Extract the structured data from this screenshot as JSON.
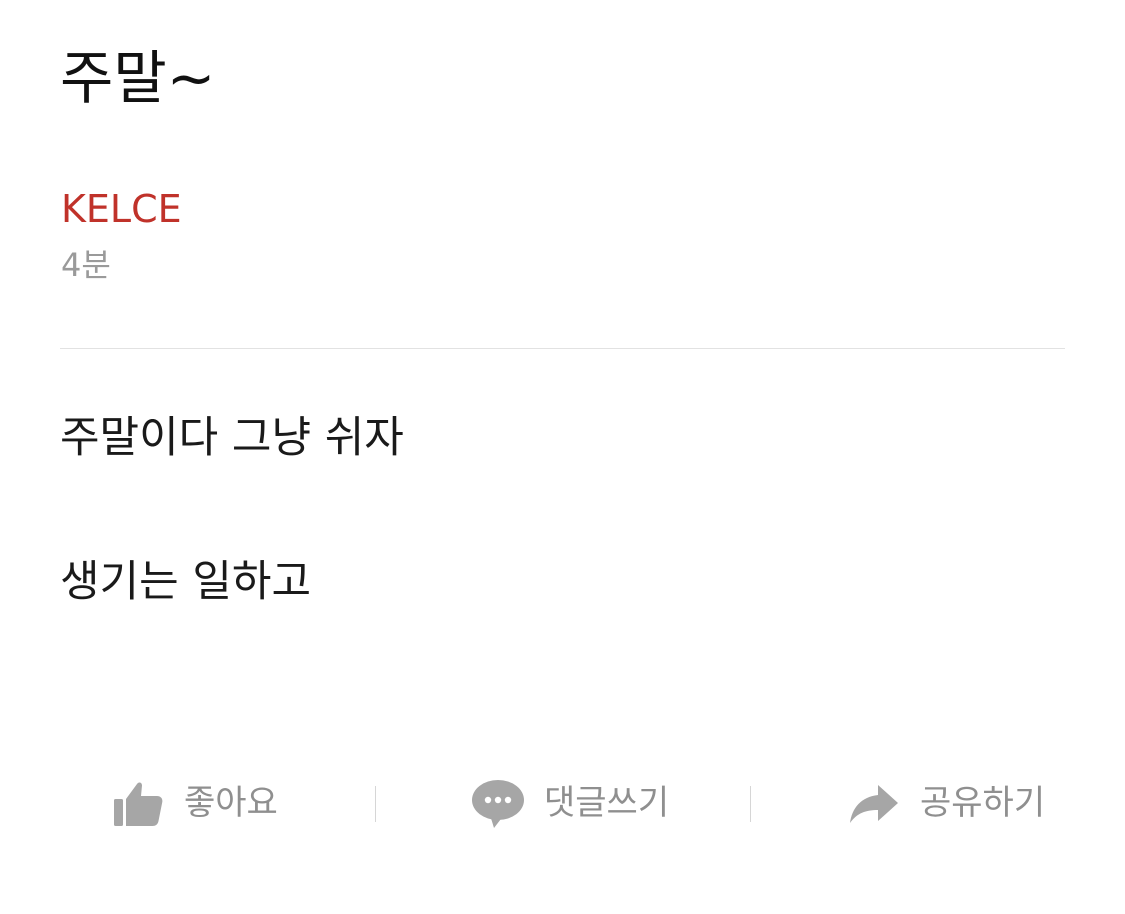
{
  "post": {
    "title": "주말~",
    "author": "KELCE",
    "time_ago": "4분",
    "body_lines": [
      "주말이다 그냥 쉬자",
      "생기는 일하고"
    ]
  },
  "actions": {
    "like": {
      "label": "좋아요",
      "icon": "thumbs-up-icon"
    },
    "comment": {
      "label": "댓글쓰기",
      "icon": "speech-bubble-icon"
    },
    "share": {
      "label": "공유하기",
      "icon": "share-arrow-icon"
    }
  },
  "colors": {
    "author": "#c0322a",
    "meta": "#9a9a9a",
    "icon": "#a6a6a6",
    "action_text": "#8f8f8f"
  }
}
